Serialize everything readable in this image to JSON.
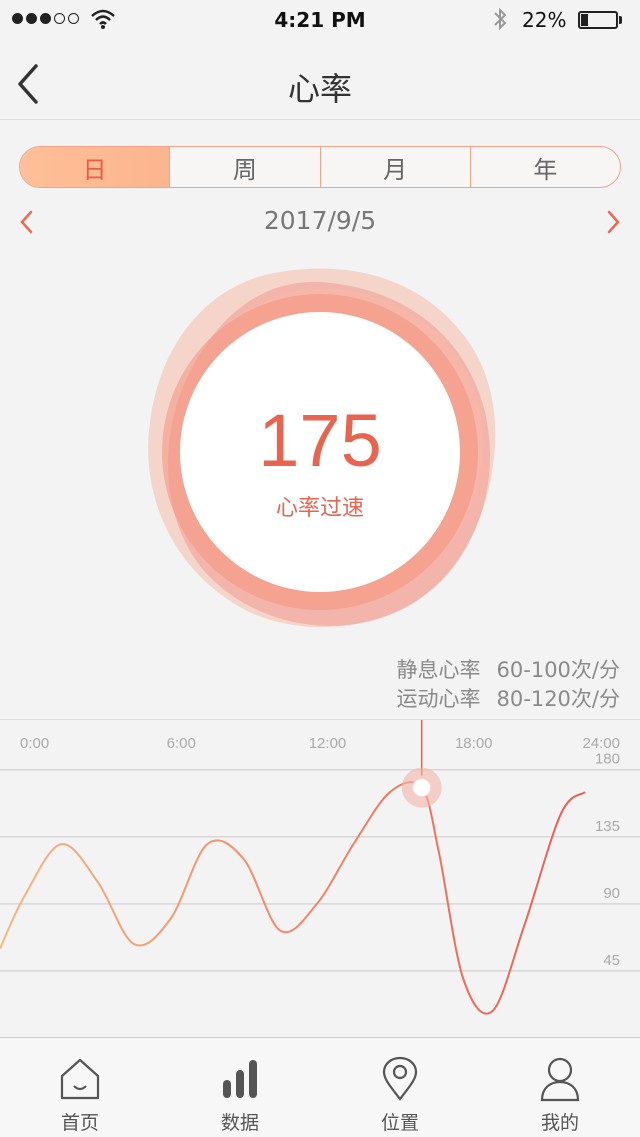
{
  "status_bar": {
    "time": "4:21 PM",
    "battery_percent": "22%",
    "signal_bars_filled": 3,
    "signal_bars_total": 5,
    "battery_level": 0.22,
    "icons": [
      "wifi-icon",
      "bluetooth-icon",
      "battery-icon"
    ]
  },
  "nav": {
    "title": "心率",
    "back_icon": "chevron-left-icon"
  },
  "segments": [
    {
      "label": "日",
      "active": true
    },
    {
      "label": "周",
      "active": false
    },
    {
      "label": "月",
      "active": false
    },
    {
      "label": "年",
      "active": false
    }
  ],
  "date_nav": {
    "date": "2017/9/5",
    "prev_icon": "chevron-left-icon",
    "next_icon": "chevron-right-icon"
  },
  "heart_rate": {
    "value": "175",
    "status": "心率过速"
  },
  "reference": [
    {
      "label": "静息心率",
      "range": "60-100次/分"
    },
    {
      "label": "运动心率",
      "range": "80-120次/分"
    }
  ],
  "chart_data": {
    "type": "line",
    "x_ticks": [
      "0:00",
      "6:00",
      "12:00",
      "18:00",
      "24:00"
    ],
    "y_ticks": [
      "180",
      "135",
      "90",
      "45"
    ],
    "xlim": [
      0,
      24
    ],
    "ylim": [
      0,
      210
    ],
    "grid": true,
    "series": [
      {
        "x": [
          0,
          1,
          2.5,
          4,
          5.5,
          7,
          8.5,
          10,
          11.5,
          13,
          14.5,
          16,
          17.3,
          18,
          19,
          20.2,
          21.5,
          23,
          24
        ],
        "values": [
          60,
          95,
          130,
          105,
          63,
          80,
          130,
          120,
          72,
          90,
          130,
          165,
          168,
          125,
          40,
          18,
          75,
          150,
          165
        ]
      }
    ],
    "highlight": {
      "x": 17.3,
      "value": 168
    },
    "colors": {
      "start": "#f8b57e",
      "end": "#ef5a4e"
    }
  },
  "tabs": [
    {
      "label": "首页",
      "icon": "home-icon"
    },
    {
      "label": "数据",
      "icon": "bar-chart-icon"
    },
    {
      "label": "位置",
      "icon": "location-pin-icon"
    },
    {
      "label": "我的",
      "icon": "user-icon"
    }
  ],
  "colors": {
    "accent": "#e8644e",
    "segment_active": "#fcb58e",
    "background": "#f4f3f3"
  }
}
